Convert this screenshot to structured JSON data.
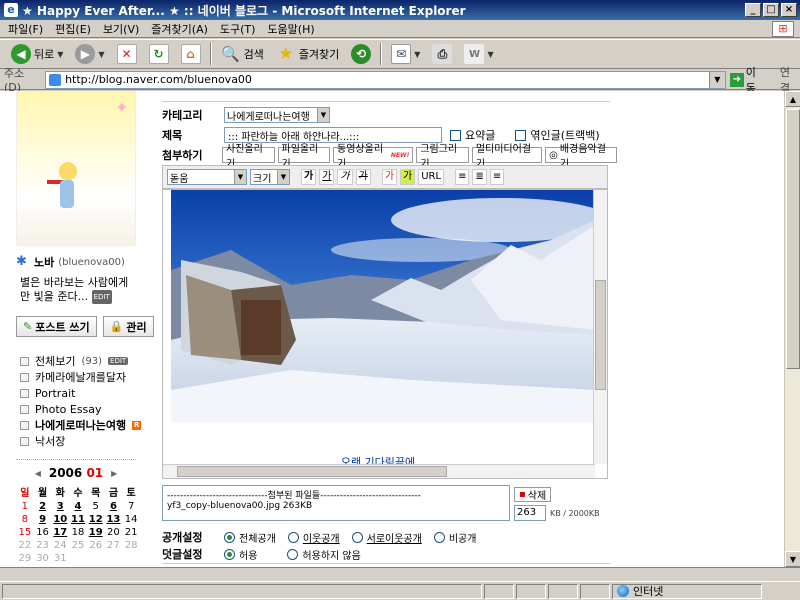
{
  "window": {
    "title": "★ Happy Ever After... ★ :: 네이버 블로그 - Microsoft Internet Explorer"
  },
  "menu": [
    "파일(F)",
    "편집(E)",
    "보기(V)",
    "즐겨찾기(A)",
    "도구(T)",
    "도움말(H)"
  ],
  "toolbar": {
    "back": "뒤로",
    "search": "검색",
    "favorites": "즐겨찾기"
  },
  "address": {
    "label": "주소(D)",
    "url": "http://blog.naver.com/bluenova00",
    "go": "이동",
    "links": "연결"
  },
  "status": {
    "zone": "인터넷"
  },
  "profile": {
    "name": "노바",
    "id": "(bluenova00)",
    "message_line1": "별은 바라보는 사람에게",
    "message_line2": "만 빛을 준다...",
    "edit_badge": "EDIT"
  },
  "side_buttons": {
    "post": "포스트 쓰기",
    "manage": "관리"
  },
  "categories": [
    {
      "label": "전체보기",
      "count": "(93)",
      "badge": "EDIT"
    },
    {
      "label": "카메라에날개를달자"
    },
    {
      "label": "Portrait"
    },
    {
      "label": "Photo Essay"
    },
    {
      "label": "나에게로떠나는여행"
    },
    {
      "label": "낙서장"
    }
  ],
  "calendar": {
    "year": "2006",
    "month": "01",
    "weekdays": [
      "일",
      "월",
      "화",
      "수",
      "목",
      "금",
      "토"
    ],
    "rows": [
      [
        "1",
        "2",
        "3",
        "4",
        "5",
        "6",
        "7"
      ],
      [
        "8",
        "9",
        "10",
        "11",
        "12",
        "13",
        "14"
      ],
      [
        "15",
        "16",
        "17",
        "18",
        "19",
        "20",
        "21"
      ],
      [
        "22",
        "23",
        "24",
        "25",
        "26",
        "27",
        "28"
      ],
      [
        "29",
        "30",
        "31",
        "",
        "",
        "",
        ""
      ]
    ]
  },
  "editor": {
    "category_label": "카테고리",
    "category_value": "나에게로떠나는여행",
    "title_label": "제목",
    "title_value": "::: 파란하늘 아래 하얀나라...:::",
    "summary_label": "요약글",
    "trackback_label": "엮인글(트랙백)",
    "attach_label": "첨부하기",
    "attach_buttons": [
      "사진올리기",
      "파일올리기",
      "동영상올리기",
      "그림그리기",
      "멀티미디어걸기",
      "배경음악걸기"
    ],
    "new_badge": "NEW!",
    "font_select": "돋움",
    "size_select": "크기",
    "format_buttons": [
      "가",
      "가",
      "가",
      "가"
    ],
    "color_buttons": [
      "가",
      "가"
    ],
    "url_button": "URL",
    "caption": "...오랜 기다림끝에...",
    "files_header": "-------------------------------첨부된 파일들-------------------------------",
    "file_entry": "yf3_copy-bluenova00.jpg    263KB",
    "delete_button": "삭제",
    "size_value": "263",
    "size_unit": "KB / 2000KB",
    "visibility_label": "공개설정",
    "visibility_options": [
      "전체공개",
      "이웃공개",
      "서로이웃공개",
      "비공개"
    ],
    "comment_label": "덧글설정",
    "comment_options": [
      "허용",
      "허용하지 않음"
    ]
  }
}
